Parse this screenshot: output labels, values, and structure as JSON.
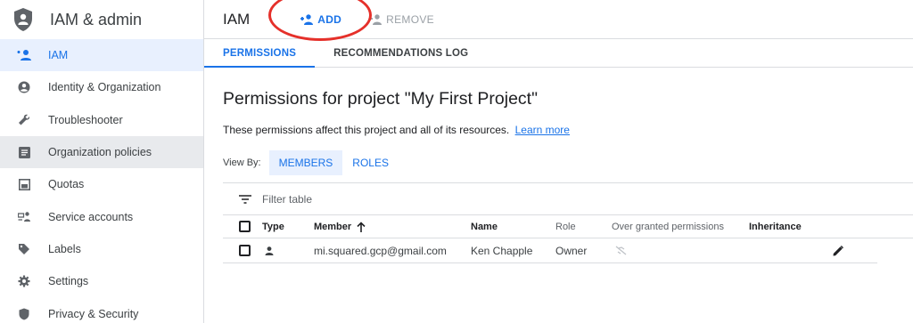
{
  "sidebar": {
    "title": "IAM & admin",
    "items": [
      {
        "label": "IAM",
        "icon": "add-person-icon"
      },
      {
        "label": "Identity & Organization",
        "icon": "account-circle-icon"
      },
      {
        "label": "Troubleshooter",
        "icon": "wrench-icon"
      },
      {
        "label": "Organization policies",
        "icon": "list-doc-icon"
      },
      {
        "label": "Quotas",
        "icon": "quota-icon"
      },
      {
        "label": "Service accounts",
        "icon": "service-account-icon"
      },
      {
        "label": "Labels",
        "icon": "label-icon"
      },
      {
        "label": "Settings",
        "icon": "gear-icon"
      },
      {
        "label": "Privacy & Security",
        "icon": "shield-icon"
      }
    ]
  },
  "header": {
    "title": "IAM",
    "add_label": "ADD",
    "remove_label": "REMOVE"
  },
  "tabs": {
    "permissions": "PERMISSIONS",
    "recommendations": "RECOMMENDATIONS LOG"
  },
  "main": {
    "heading": "Permissions for project \"My First Project\"",
    "description": "These permissions affect this project and all of its resources.",
    "learn_more": "Learn more",
    "view_by_label": "View By:",
    "view_members": "MEMBERS",
    "view_roles": "ROLES",
    "filter_placeholder": "Filter table"
  },
  "table": {
    "columns": {
      "type": "Type",
      "member": "Member",
      "name": "Name",
      "role": "Role",
      "over_granted": "Over granted permissions",
      "inheritance": "Inheritance"
    },
    "rows": [
      {
        "member": "mi.squared.gcp@gmail.com",
        "name": "Ken Chapple",
        "role": "Owner"
      }
    ]
  },
  "colors": {
    "accent": "#1a73e8",
    "annotation": "#e5302a"
  }
}
